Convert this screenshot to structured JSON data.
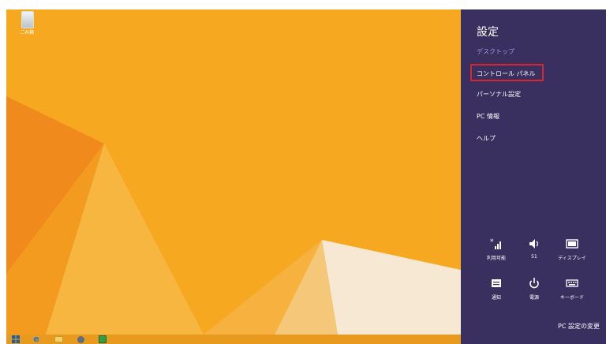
{
  "desktop": {
    "recycle_bin_label": "ごみ箱"
  },
  "charm": {
    "title": "設定",
    "items": [
      {
        "label": "デスクトップ"
      },
      {
        "label": "コントロール パネル"
      },
      {
        "label": "パーソナル設定"
      },
      {
        "label": "PC 情報"
      },
      {
        "label": "ヘルプ"
      }
    ],
    "quick_settings": [
      {
        "label": "利用可能",
        "icon": "network-icon"
      },
      {
        "label": "51",
        "icon": "volume-icon"
      },
      {
        "label": "ディスプレイ",
        "icon": "display-icon"
      },
      {
        "label": "通知",
        "icon": "notifications-icon"
      },
      {
        "label": "電源",
        "icon": "power-icon"
      },
      {
        "label": "キーボード",
        "icon": "keyboard-icon"
      }
    ],
    "pc_settings_link": "PC 設定の変更"
  },
  "colors": {
    "charm_bg": "#3a3060",
    "highlight": "#d8262e",
    "desktop_bg": "#f5a623"
  }
}
